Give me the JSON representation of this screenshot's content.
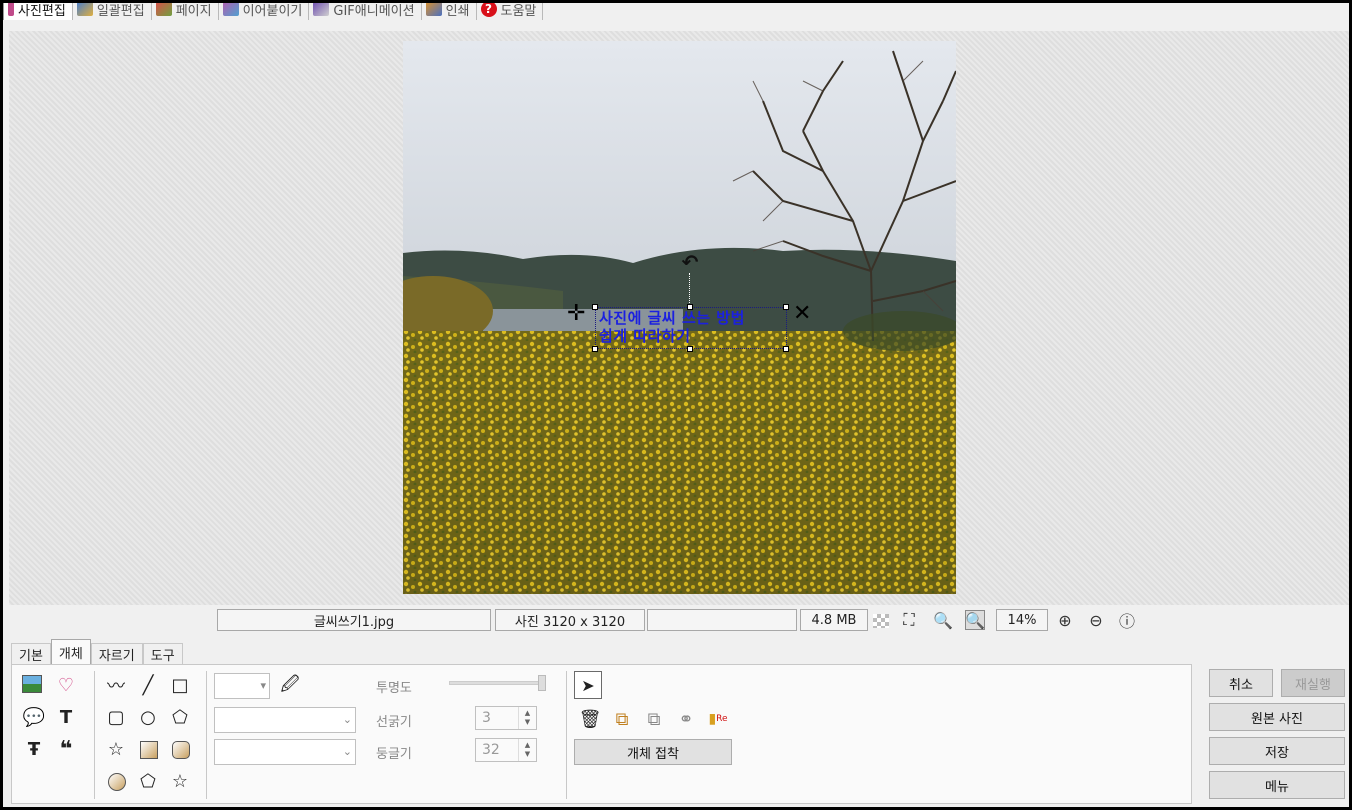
{
  "top_tabs": [
    {
      "label": "사진편집",
      "icon": "photo-edit-icon",
      "color": "#c04a8a",
      "active": true
    },
    {
      "label": "일괄편집",
      "icon": "batch-edit-icon",
      "color": "#4a7ec9",
      "active": false
    },
    {
      "label": "페이지",
      "icon": "page-icon",
      "color": "#d8504a",
      "active": false
    },
    {
      "label": "이어붙이기",
      "icon": "merge-icon",
      "color": "#b060b0",
      "active": false
    },
    {
      "label": "GIF애니메이션",
      "icon": "gif-animation-icon",
      "color": "#7050b0",
      "active": false
    },
    {
      "label": "인쇄",
      "icon": "print-icon",
      "color": "#d89030",
      "active": false
    },
    {
      "label": "도움말",
      "icon": "help-icon",
      "color": "#d8101a",
      "active": false
    }
  ],
  "text_object": {
    "line1": "사진에 글씨 쓰는 방법",
    "line2": "쉽게 따라하기",
    "color": "#1b20e0"
  },
  "status": {
    "filename": "글씨쓰기1.jpg",
    "dimensions": "사진 3120 x 3120",
    "empty": "",
    "filesize": "4.8 MB",
    "zoom": "14%"
  },
  "panel_tabs": [
    {
      "label": "기본",
      "active": false
    },
    {
      "label": "개체",
      "active": true
    },
    {
      "label": "자르기",
      "active": false
    },
    {
      "label": "도구",
      "active": false
    }
  ],
  "props": {
    "opacity_label": "투명도",
    "line_width_label": "선굵기",
    "line_width_value": "3",
    "roundness_label": "둥글기",
    "roundness_value": "32"
  },
  "object_attach_label": "개체 접착",
  "buttons": {
    "cancel": "취소",
    "redo": "재실행",
    "original": "원본 사진",
    "save": "저장",
    "menu": "메뉴"
  }
}
